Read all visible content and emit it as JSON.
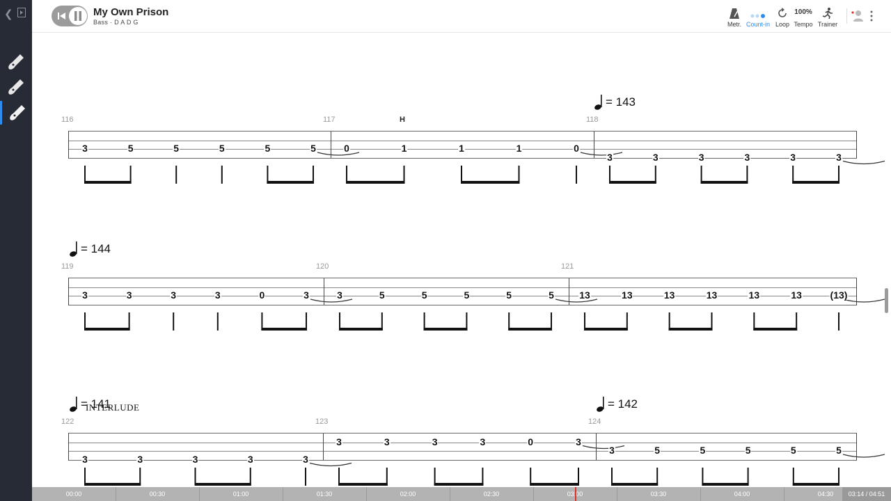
{
  "song": {
    "title": "My Own Prison",
    "subtitle": "Bass · D A D G"
  },
  "toolbar": {
    "metronome": "Metr.",
    "countin": "Count-in",
    "loop": "Loop",
    "tempo_value": "100%",
    "tempo": "Tempo",
    "trainer": "Trainer"
  },
  "colors": {
    "accent": "#2d8cf0",
    "sidebar": "#262b35",
    "playhead": "#e0302c"
  },
  "score": {
    "systems": [
      {
        "bars": [
          {
            "number": "116",
            "notes": [
              {
                "fret": "3",
                "string": 2
              },
              {
                "fret": "5",
                "string": 2
              },
              {
                "fret": "5",
                "string": 2
              },
              {
                "fret": "5",
                "string": 2
              },
              {
                "fret": "5",
                "string": 2
              },
              {
                "fret": "5",
                "string": 2
              }
            ]
          },
          {
            "number": "117",
            "technique": "H",
            "notes": [
              {
                "fret": "0",
                "string": 2
              },
              {
                "fret": "1",
                "string": 2
              },
              {
                "fret": "1",
                "string": 2
              },
              {
                "fret": "1",
                "string": 2
              },
              {
                "fret": "0",
                "string": 2
              }
            ]
          },
          {
            "number": "118",
            "tempo": "= 143",
            "notes": [
              {
                "fret": "3",
                "string": 3
              },
              {
                "fret": "3",
                "string": 3
              },
              {
                "fret": "3",
                "string": 3
              },
              {
                "fret": "3",
                "string": 3
              },
              {
                "fret": "3",
                "string": 3
              },
              {
                "fret": "3",
                "string": 3
              }
            ]
          }
        ]
      },
      {
        "tempo": "= 144",
        "bars": [
          {
            "number": "119",
            "notes": [
              {
                "fret": "3",
                "string": 2
              },
              {
                "fret": "3",
                "string": 2
              },
              {
                "fret": "3",
                "string": 2
              },
              {
                "fret": "3",
                "string": 2
              },
              {
                "fret": "0",
                "string": 2
              },
              {
                "fret": "3",
                "string": 2
              }
            ]
          },
          {
            "number": "120",
            "notes": [
              {
                "fret": "3",
                "string": 2
              },
              {
                "fret": "5",
                "string": 2
              },
              {
                "fret": "5",
                "string": 2
              },
              {
                "fret": "5",
                "string": 2
              },
              {
                "fret": "5",
                "string": 2
              },
              {
                "fret": "5",
                "string": 2
              }
            ]
          },
          {
            "number": "121",
            "notes": [
              {
                "fret": "13",
                "string": 2
              },
              {
                "fret": "13",
                "string": 2
              },
              {
                "fret": "13",
                "string": 2
              },
              {
                "fret": "13",
                "string": 2
              },
              {
                "fret": "13",
                "string": 2
              },
              {
                "fret": "13",
                "string": 2
              },
              {
                "fret": "(13)",
                "string": 2
              }
            ]
          }
        ]
      },
      {
        "tempo": "= 141",
        "section": "INTERLUDE",
        "bars": [
          {
            "number": "122",
            "notes": [
              {
                "fret": "3",
                "string": 3
              },
              {
                "fret": "3",
                "string": 3
              },
              {
                "fret": "3",
                "string": 3
              },
              {
                "fret": "3",
                "string": 3
              },
              {
                "fret": "3",
                "string": 3
              }
            ]
          },
          {
            "number": "123",
            "notes": [
              {
                "fret": "3",
                "string": 1
              },
              {
                "fret": "3",
                "string": 1
              },
              {
                "fret": "3",
                "string": 1
              },
              {
                "fret": "3",
                "string": 1
              },
              {
                "fret": "0",
                "string": 1
              },
              {
                "fret": "3",
                "string": 1
              }
            ]
          },
          {
            "number": "124",
            "tempo": "= 142",
            "notes": [
              {
                "fret": "3",
                "string": 2
              },
              {
                "fret": "5",
                "string": 2
              },
              {
                "fret": "5",
                "string": 2
              },
              {
                "fret": "5",
                "string": 2
              },
              {
                "fret": "5",
                "string": 2
              },
              {
                "fret": "5",
                "string": 2
              }
            ]
          }
        ]
      }
    ]
  },
  "timeline": {
    "labels": [
      "00:00",
      "00:30",
      "01:00",
      "01:30",
      "02:00",
      "02:30",
      "03:00",
      "03:30",
      "04:00",
      "04:30"
    ],
    "counter": "03:14 / 04:51",
    "progress": 0.667
  }
}
